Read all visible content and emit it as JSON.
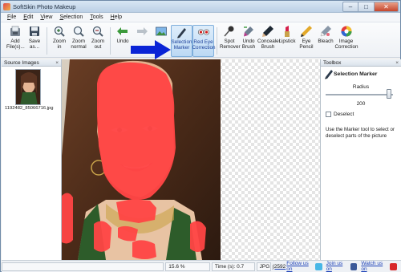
{
  "window": {
    "title": "SoftSkin Photo Makeup"
  },
  "menu": [
    "File",
    "Edit",
    "View",
    "Selection",
    "Tools",
    "Help"
  ],
  "toolbar": {
    "add_files": "Add File(s)...",
    "save_as": "Save as...",
    "zoom_in": "Zoom in",
    "zoom_normal": "Zoom normal",
    "zoom_out": "Zoom out",
    "undo": "Undo",
    "selection_marker": "Selection Marker",
    "red_eye": "Red Eye Correction",
    "spot_remover": "Spot Remover",
    "undo_brush": "Undo Brush",
    "concealer_brush": "Concealer Brush",
    "lipstick": "Lipstick",
    "eye_pencil": "Eye Pencil",
    "bleach": "Bleach",
    "image_correction": "Image Correction"
  },
  "source_images": {
    "title": "Source Images",
    "close": "×",
    "file_name": "1192482_85066716.jpg"
  },
  "toolbox": {
    "title": "Toolbox",
    "close": "×",
    "tool_name": "Selection Marker",
    "radius_label": "Radius",
    "radius_value": "200",
    "radius_fraction": 0.97,
    "deselect_label": "Deselect",
    "help_text": "Use the Marker tool to select or deselect parts of the picture"
  },
  "status": {
    "zoom": "15.6 %",
    "time": "Time (s): 0.7",
    "format": "JPG",
    "size": "(2592",
    "follow": "Follow us on",
    "join": "Join us on",
    "watch": "Watch us on"
  },
  "colors": {
    "selection": "#ff4545",
    "accent_blue": "#0a24d6",
    "window_frame": "#6f8aa8"
  }
}
